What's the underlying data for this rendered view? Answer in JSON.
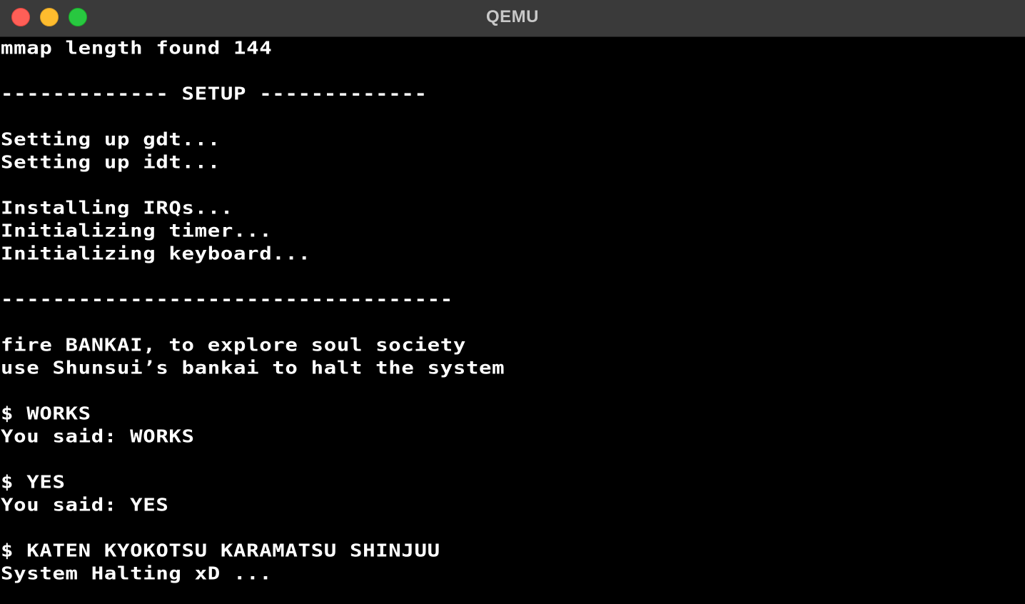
{
  "window": {
    "title": "QEMU",
    "buttons": [
      "close",
      "minimize",
      "zoom"
    ]
  },
  "terminal": {
    "lines": [
      "mmap length found 144",
      "",
      "------------- SETUP -------------",
      "",
      "Setting up gdt...",
      "Setting up idt...",
      "",
      "Installing IRQs...",
      "Initializing timer...",
      "Initializing keyboard...",
      "",
      "-----------------------------------",
      "",
      "fire BANKAI, to explore soul society",
      "use Shunsui’s bankai to halt the system",
      "",
      "$ WORKS",
      "You said: WORKS",
      "",
      "$ YES",
      "You said: YES",
      "",
      "$ KATEN KYOKOTSU KARAMATSU SHINJUU",
      "System Halting xD ..."
    ]
  },
  "colors": {
    "background": "#000000",
    "text": "#ffffff",
    "titlebar": "#3a3a3a",
    "title_text": "#c8c8c8",
    "close": "#ff5f57",
    "minimize": "#febc2e",
    "zoom": "#28c840"
  }
}
